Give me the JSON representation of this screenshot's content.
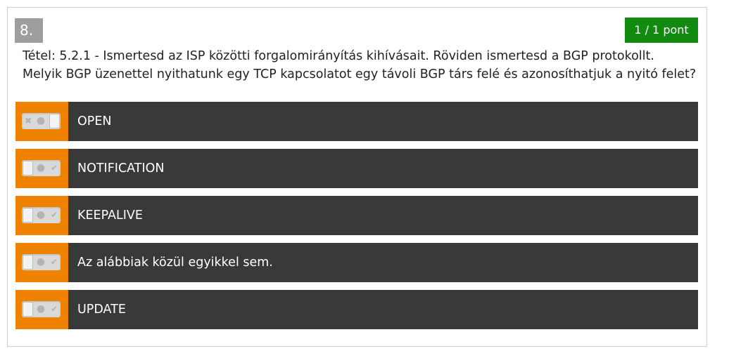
{
  "question": {
    "number": "8.",
    "score": "1 / 1 pont",
    "text_lines": [
      "Tétel: 5.2.1 - Ismertesd az ISP közötti forgalomirányítás kihívásait. Röviden ismertesd a BGP protokollt.",
      "Melyik BGP üzenettel nyithatunk egy TCP kapcsolatot egy távoli BGP társ felé és azonosíthatjuk a nyitó felet?"
    ]
  },
  "options": [
    {
      "label": "OPEN",
      "toggle_state": "check"
    },
    {
      "label": "NOTIFICATION",
      "toggle_state": "x"
    },
    {
      "label": "KEEPALIVE",
      "toggle_state": "x"
    },
    {
      "label": "Az alábbiak közül egyikkel sem.",
      "toggle_state": "x"
    },
    {
      "label": "UPDATE",
      "toggle_state": "x"
    }
  ],
  "icons": {
    "x": "✖",
    "dot": "●",
    "check": "✔"
  },
  "colors": {
    "indicator": "#ef8200",
    "option_bg": "#393939",
    "score_bg": "#118a10",
    "number_bg": "#9e9e9e"
  }
}
